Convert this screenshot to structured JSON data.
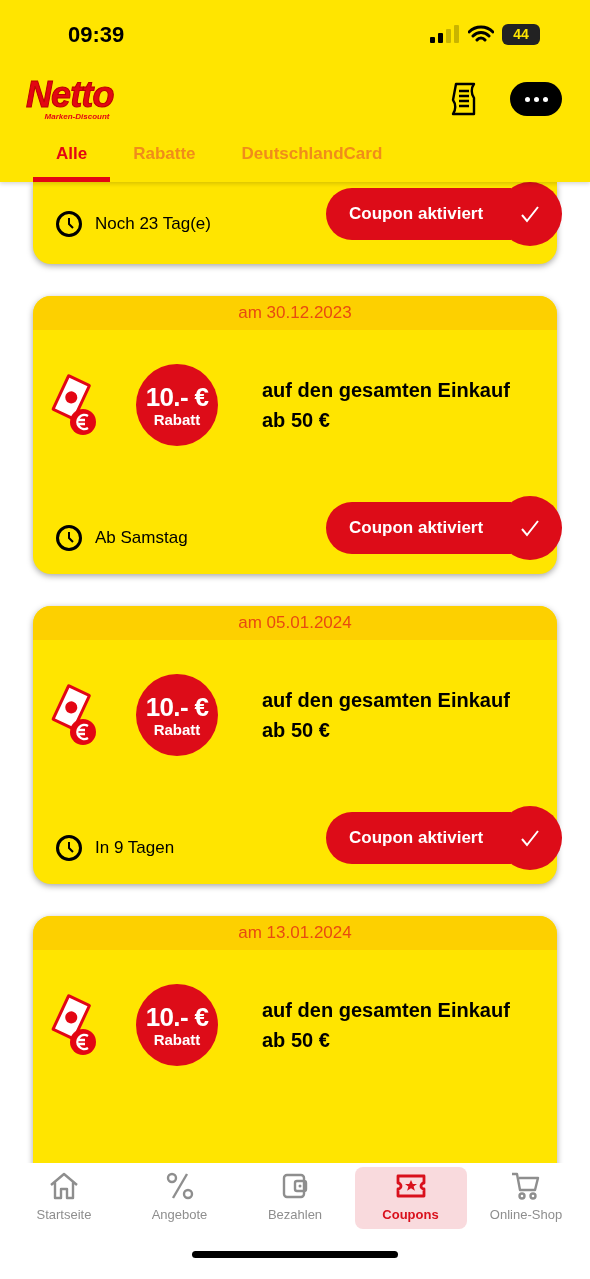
{
  "status_bar": {
    "time": "09:39",
    "battery": "44"
  },
  "header": {
    "logo": "Netto",
    "logo_sub": "Marken-Discount"
  },
  "tabs": [
    {
      "label": "Alle",
      "selected": true
    },
    {
      "label": "Rabatte",
      "selected": false
    },
    {
      "label": "DeutschlandCard",
      "selected": false
    }
  ],
  "coupons": [
    {
      "kind": "footer_only",
      "timer": "Noch 23 Tag(e)",
      "button": "Coupon aktiviert",
      "activated": true
    },
    {
      "kind": "full",
      "date": "am 30.12.2023",
      "amount": "10.- €",
      "amount_label": "Rabatt",
      "title": "auf den gesamten Einkauf ab 50 €",
      "timer": "Ab Samstag",
      "button": "Coupon aktiviert",
      "activated": true
    },
    {
      "kind": "full",
      "date": "am 05.01.2024",
      "amount": "10.- €",
      "amount_label": "Rabatt",
      "title": "auf den gesamten Einkauf ab 50 €",
      "timer": "In 9 Tagen",
      "button": "Coupon aktiviert",
      "activated": true
    },
    {
      "kind": "top_only",
      "date": "am 13.01.2024",
      "amount": "10.- €",
      "amount_label": "Rabatt",
      "title": "auf den gesamten Einkauf ab 50 €"
    }
  ],
  "nav": [
    {
      "kind": "home",
      "label": "Startseite",
      "selected": false
    },
    {
      "kind": "percent",
      "label": "Angebote",
      "selected": false
    },
    {
      "kind": "wallet",
      "label": "Bezahlen",
      "selected": false
    },
    {
      "kind": "ticket",
      "label": "Coupons",
      "selected": true
    },
    {
      "kind": "cart",
      "label": "Online-Shop",
      "selected": false
    }
  ]
}
